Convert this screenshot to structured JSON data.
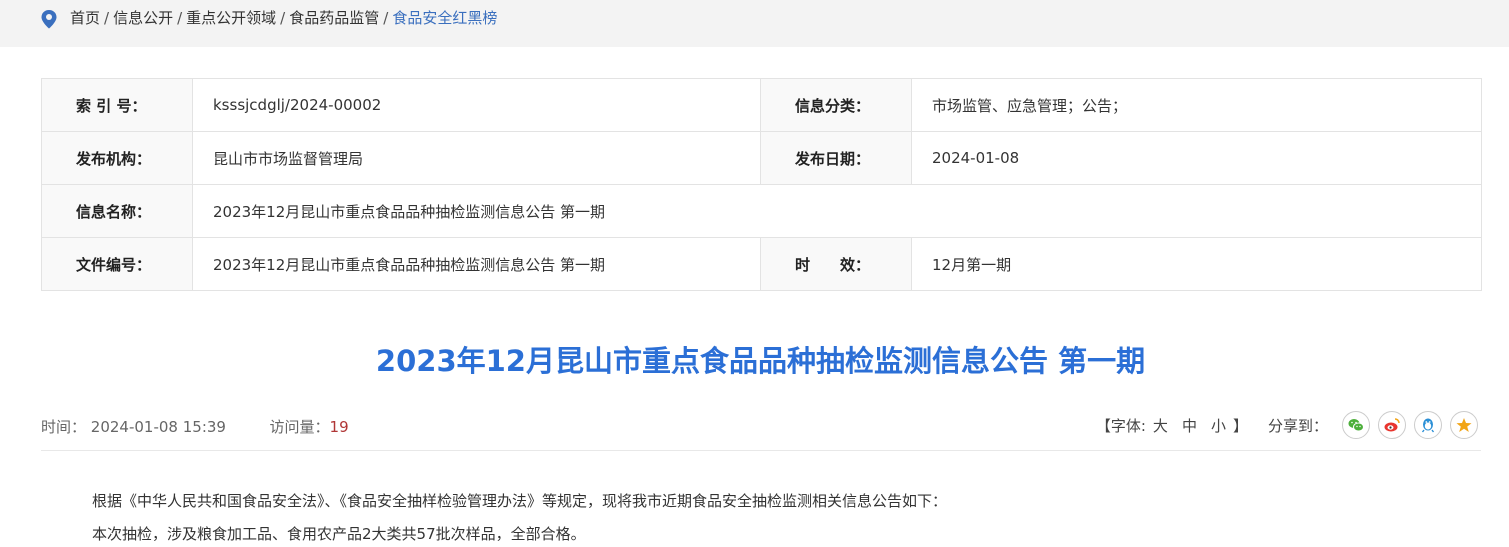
{
  "breadcrumb": {
    "items": [
      "首页",
      "信息公开",
      "重点公开领域",
      "食品药品监管",
      "食品安全红黑榜"
    ],
    "separator": "/"
  },
  "info_table": {
    "index_label": "索 引 号：",
    "index_value": "ksssjcdglj/2024-00002",
    "category_label": "信息分类：",
    "category_value": "市场监管、应急管理；公告；",
    "publisher_label": "发布机构：",
    "publisher_value": "昆山市市场监督管理局",
    "date_label": "发布日期：",
    "date_value": "2024-01-08",
    "name_label": "信息名称：",
    "name_value": "2023年12月昆山市重点食品品种抽检监测信息公告 第一期",
    "docnum_label": "文件编号：",
    "docnum_value": "2023年12月昆山市重点食品品种抽检监测信息公告 第一期",
    "validity_label": "时　　效：",
    "validity_value": "12月第一期"
  },
  "article": {
    "title": "2023年12月昆山市重点食品品种抽检监测信息公告 第一期",
    "time_label": "时间：",
    "time_value": "2024-01-08 15:39",
    "views_label": "访问量：",
    "views_value": "19",
    "paragraphs": [
      "根据《中华人民共和国食品安全法》、《食品安全抽样检验管理办法》等规定，现将我市近期食品安全抽检监测相关信息公告如下：",
      "本次抽检，涉及粮食加工品、食用农产品2大类共57批次样品，全部合格。"
    ]
  },
  "toolbar": {
    "font_open": "【字体:",
    "font_large": "大",
    "font_medium": "中",
    "font_small": "小",
    "font_close": "】",
    "share_label": "分享到："
  },
  "colors": {
    "accent": "#2b6fd6",
    "crumb_current": "#3a6fbe",
    "views_count": "#b03636",
    "wechat": "#4caf3a",
    "weibo": "#e8352e",
    "qq": "#2a8fd6",
    "qzone": "#f2a516"
  }
}
